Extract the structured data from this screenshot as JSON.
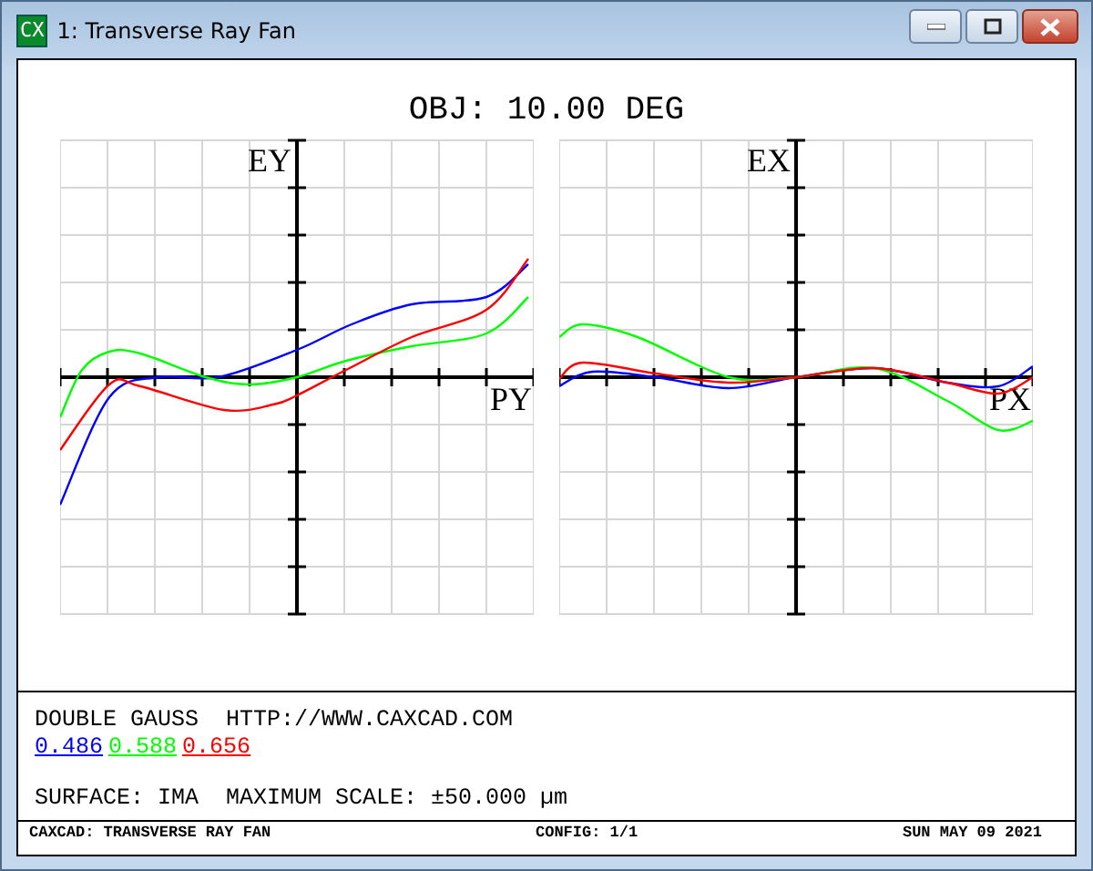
{
  "window": {
    "title": "1: Transverse Ray Fan",
    "app_icon": "CX"
  },
  "plot": {
    "title": "OBJ: 10.00 DEG",
    "panels": [
      {
        "y_label": "EY",
        "x_label": "PY"
      },
      {
        "y_label": "EX",
        "x_label": "PX"
      }
    ]
  },
  "info": {
    "line_1": "DOUBLE GAUSS  HTTP://WWW.CAXCAD.COM",
    "wavelengths": [
      {
        "label": "0.486",
        "color": "#0000ff"
      },
      {
        "label": "0.588",
        "color": "#00ff00"
      },
      {
        "label": "0.656",
        "color": "#ff0000"
      }
    ],
    "line_2": "SURFACE: IMA  MAXIMUM SCALE: ±50.000 µm"
  },
  "footer": {
    "left": "CAXCAD: TRANSVERSE RAY FAN",
    "center": "CONFIG: 1/1",
    "right": "SUN MAY 09 2021"
  }
}
